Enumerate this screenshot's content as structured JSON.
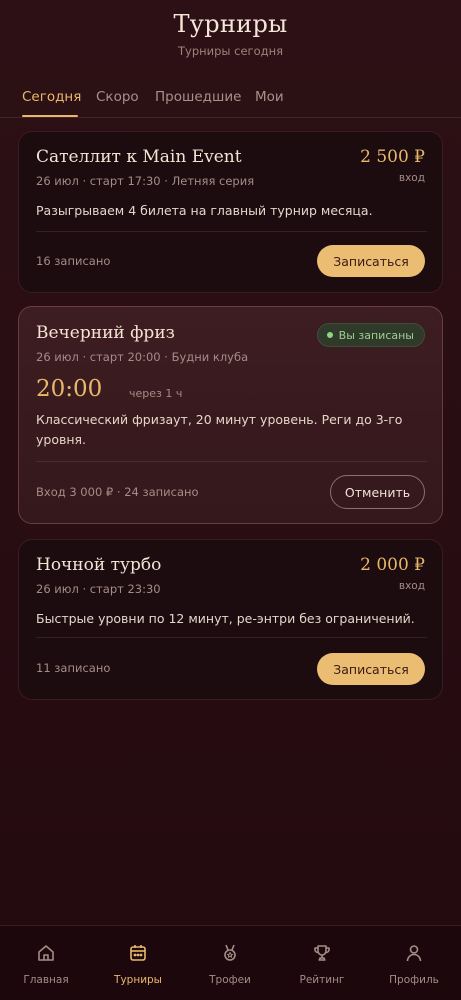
{
  "header": {
    "title": "Турниры",
    "subtitle": "Турниры сегодня"
  },
  "tabs": [
    {
      "label": "Сегодня",
      "active": true
    },
    {
      "label": "Скоро",
      "active": false
    },
    {
      "label": "Прошедшие",
      "active": false
    },
    {
      "label": "Мои",
      "active": false
    }
  ],
  "tournaments": [
    {
      "title": "Сателлит к Main Event",
      "meta": "26 июл · старт 17:30 · Летняя серия",
      "price": "2 500 ₽",
      "price_label": "вход",
      "description": "Разыгрываем 4 билета на главный турнир месяца.",
      "registered": "16 записано",
      "action": "Записаться"
    },
    {
      "title": "Вечерний фриз",
      "meta": "26 июл · старт 20:00 · Будни клуба",
      "badge": "Вы записаны",
      "start_time": "20:00",
      "countdown": "через 1 ч",
      "description": "Классический фризаут, 20 минут уровень. Реги до 3-го уровня.",
      "footer": "Вход 3 000 ₽ · 24 записано",
      "action": "Отменить"
    },
    {
      "title": "Ночной турбо",
      "meta": "26 июл · старт 23:30",
      "price": "2 000 ₽",
      "price_label": "вход",
      "description": "Быстрые уровни по 12 минут, ре-энтри без ограничений.",
      "registered": "11 записано",
      "action": "Записаться"
    }
  ],
  "nav": [
    {
      "label": "Главная",
      "icon": "home-icon",
      "active": false
    },
    {
      "label": "Турниры",
      "icon": "calendar-icon",
      "active": true
    },
    {
      "label": "Трофеи",
      "icon": "medal-icon",
      "active": false
    },
    {
      "label": "Рейтинг",
      "icon": "trophy-icon",
      "active": false
    },
    {
      "label": "Профиль",
      "icon": "user-icon",
      "active": false
    }
  ],
  "colors": {
    "accent": "#e8b86a",
    "background": "#2a0f14",
    "card": "#1c0b0f",
    "success": "#8fd47e"
  }
}
